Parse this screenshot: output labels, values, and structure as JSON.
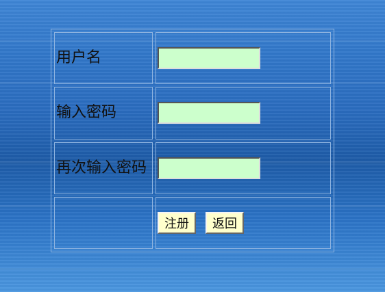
{
  "form": {
    "rows": [
      {
        "label": "用户名",
        "value": ""
      },
      {
        "label": "输入密码",
        "value": ""
      },
      {
        "label": "再次输入密码",
        "value": ""
      }
    ],
    "buttons": {
      "register": "注册",
      "back": "返回"
    }
  },
  "colors": {
    "background": "#2e70c2",
    "input_fill": "#ccffcc",
    "button_fill": "#ffffcc",
    "border": "#8fb4e0"
  }
}
